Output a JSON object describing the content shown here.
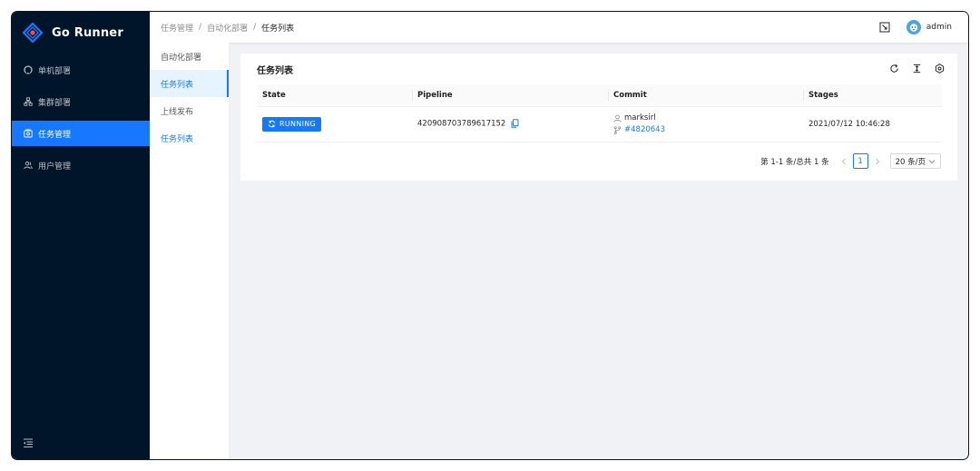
{
  "app": {
    "title": "Go Runner"
  },
  "sidebar": {
    "items": [
      {
        "label": "单机部署",
        "icon": "github-icon"
      },
      {
        "label": "集群部署",
        "icon": "cluster-icon"
      },
      {
        "label": "任务管理",
        "icon": "task-icon"
      },
      {
        "label": "用户管理",
        "icon": "user-group-icon"
      }
    ],
    "active_index": 2
  },
  "submenu": {
    "items": [
      {
        "label": "自动化部署"
      },
      {
        "label": "任务列表"
      },
      {
        "label": "上线发布"
      },
      {
        "label": "任务列表"
      }
    ]
  },
  "header": {
    "breadcrumb": [
      "任务管理",
      "自动化部署",
      "任务列表"
    ],
    "separator": "/",
    "username": "admin"
  },
  "card": {
    "title": "任务列表"
  },
  "table": {
    "columns": [
      "State",
      "Pipeline",
      "Commit",
      "Stages"
    ],
    "rows": [
      {
        "state": "RUNNING",
        "pipeline": "420908703789617152",
        "author": "marksirl",
        "commit": "#4820643",
        "stages": "2021/07/12 10:46:28"
      }
    ]
  },
  "pagination": {
    "total_text": "第 1-1 条/总共 1 条",
    "current_page": "1",
    "page_size": "20 条/页"
  },
  "colors": {
    "primary": "#1677ff",
    "sidebar_bg": "#001529"
  }
}
